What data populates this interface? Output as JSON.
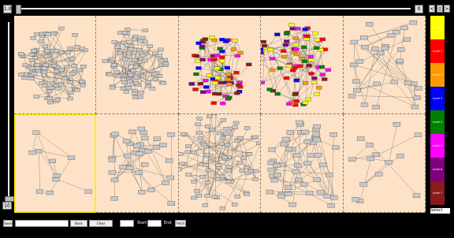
{
  "top_slider": {
    "min_label": "1.0",
    "max_label": "0",
    "buttons": [
      "<",
      "||",
      ">"
    ]
  },
  "left_slider": {
    "value_label": "10"
  },
  "grid": {
    "cols": 5,
    "rows": 2,
    "selected_index": 5
  },
  "legend": {
    "levels": [
      {
        "label": "Level 0",
        "color": "#ffff00"
      },
      {
        "label": "Level 1",
        "color": "#ff0000"
      },
      {
        "label": "Level 2",
        "color": "#ff9900"
      },
      {
        "label": "Level 3",
        "color": "#0000ff"
      },
      {
        "label": "Level 4",
        "color": "#008000"
      },
      {
        "label": "Level 5",
        "color": "#ff00ff"
      },
      {
        "label": "Level 6",
        "color": "#7f007f"
      },
      {
        "label": "Level 7",
        "color": "#8b1a1a"
      }
    ],
    "select_label": "Select"
  },
  "toolbar": {
    "save_label": "Save",
    "back_label": "Back Node",
    "clear_label": "Clear Selection",
    "start_label": "Start",
    "end_label": "End",
    "fetch_label": "Fetch"
  }
}
